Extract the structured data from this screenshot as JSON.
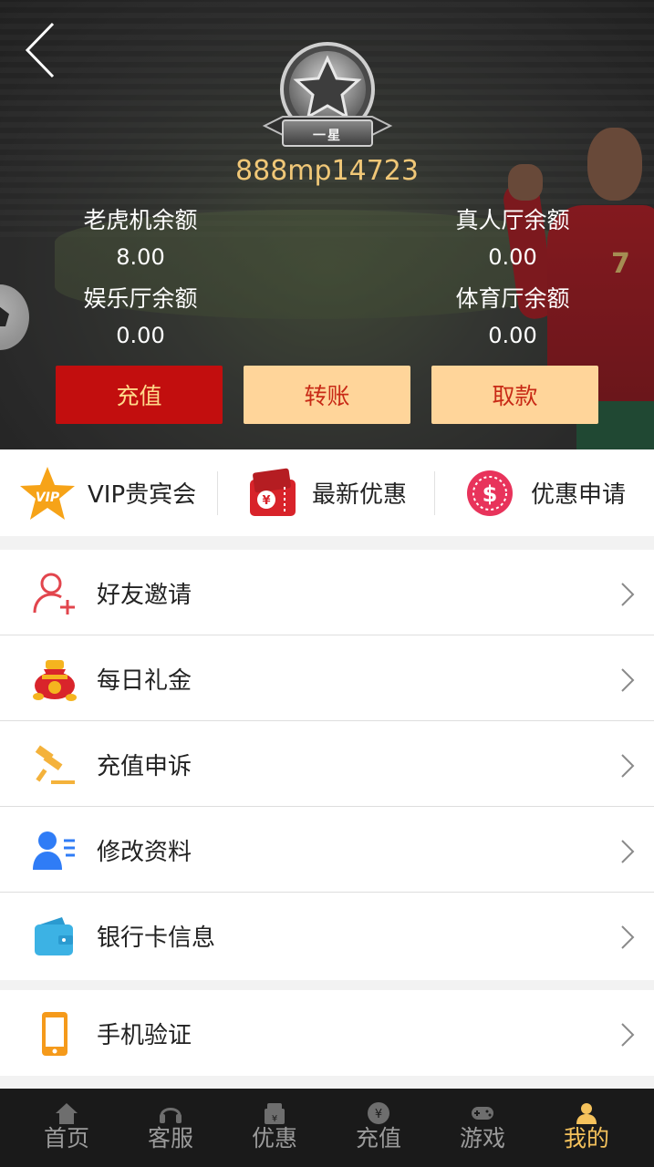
{
  "header": {
    "back_icon": "chevron-left-icon",
    "vip_level": "一星",
    "username": "888mp14723",
    "balances": [
      {
        "label": "老虎机余额",
        "value": "8.00"
      },
      {
        "label": "真人厅余额",
        "value": "0.00"
      },
      {
        "label": "娱乐厅余额",
        "value": "0.00"
      },
      {
        "label": "体育厅余额",
        "value": "0.00"
      }
    ],
    "buttons": {
      "recharge": "充值",
      "transfer": "转账",
      "withdraw": "取款"
    }
  },
  "quick_links": [
    {
      "label": "VIP贵宾会",
      "icon": "vip-star-icon"
    },
    {
      "label": "最新优惠",
      "icon": "red-envelope-icon"
    },
    {
      "label": "优惠申请",
      "icon": "dollar-coin-icon"
    }
  ],
  "menu": [
    {
      "label": "好友邀请",
      "icon": "user-add-icon"
    },
    {
      "label": "每日礼金",
      "icon": "money-bag-icon"
    },
    {
      "label": "充值申诉",
      "icon": "gavel-icon"
    },
    {
      "label": "修改资料",
      "icon": "edit-profile-icon"
    },
    {
      "label": "银行卡信息",
      "icon": "wallet-icon"
    },
    {
      "label": "手机验证",
      "icon": "phone-icon"
    }
  ],
  "tabbar": [
    {
      "label": "首页",
      "icon": "home-icon"
    },
    {
      "label": "客服",
      "icon": "headset-icon"
    },
    {
      "label": "优惠",
      "icon": "gift-icon"
    },
    {
      "label": "充值",
      "icon": "yen-coin-icon"
    },
    {
      "label": "游戏",
      "icon": "gamepad-icon"
    },
    {
      "label": "我的",
      "icon": "user-icon"
    }
  ],
  "colors": {
    "accent_gold": "#f5c25c",
    "recharge_red": "#c20e0e",
    "button_cream": "#ffd59a",
    "username_gold": "#f0c777"
  }
}
